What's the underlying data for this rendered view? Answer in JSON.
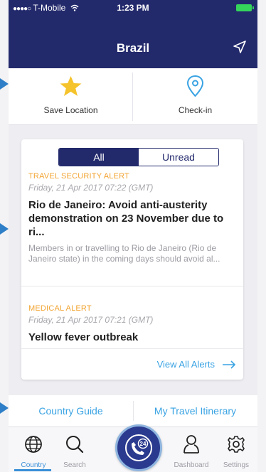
{
  "status_bar": {
    "signal": "●●●●○",
    "carrier": "T-Mobile",
    "time": "1:23 PM"
  },
  "header": {
    "title": "Brazil"
  },
  "actions": {
    "save_label": "Save Location",
    "checkin_label": "Check-in"
  },
  "alerts": {
    "filter_all": "All",
    "filter_unread": "Unread",
    "selected_filter": "All",
    "items": [
      {
        "category": "TRAVEL SECURITY ALERT",
        "date": "Friday, 21 Apr 2017 07:22 (GMT)",
        "title": "Rio de Janeiro: Avoid anti-austerity demonstration on 23 November due to ri...",
        "body": "Members in or travelling to Rio de Janeiro (Rio de Janeiro state) in the coming days should avoid al..."
      },
      {
        "category": "MEDICAL ALERT",
        "date": "Friday, 21 Apr 2017 07:21 (GMT)",
        "title": "Yellow fever outbreak",
        "body": ""
      }
    ],
    "view_all": "View All Alerts"
  },
  "links": {
    "country_guide": "Country Guide",
    "itinerary": "My Travel Itinerary"
  },
  "tabs": [
    {
      "label": "Country",
      "icon": "globe-icon",
      "active": true
    },
    {
      "label": "Search",
      "icon": "search-icon",
      "active": false
    },
    {
      "label": "",
      "icon": "call-24-icon",
      "active": false
    },
    {
      "label": "Dashboard",
      "icon": "person-icon",
      "active": false
    },
    {
      "label": "Settings",
      "icon": "gear-icon",
      "active": false
    }
  ],
  "colors": {
    "navy": "#232a6c",
    "accent_blue": "#3aa3e3",
    "alert_orange": "#f2a432",
    "star_yellow": "#f5c32b"
  }
}
